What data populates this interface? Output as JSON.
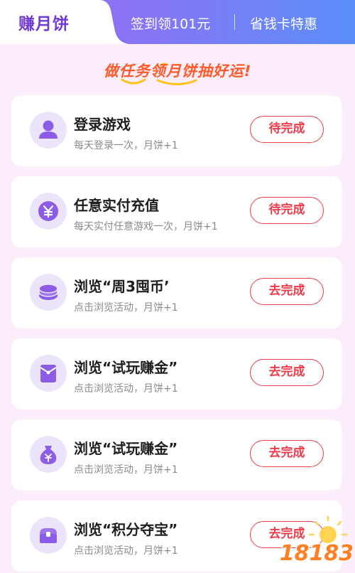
{
  "tabs": {
    "active_label": "赚月饼",
    "signin_label": "签到领101元",
    "savecard_label": "省钱卡特惠"
  },
  "slogan": "做任务领月饼抽好运!",
  "tasks": [
    {
      "title": "登录游戏",
      "desc": "每天登录一次，月饼+1",
      "button": "待完成",
      "icon": "user-icon"
    },
    {
      "title": "任意实付充值",
      "desc": "每天实付任意游戏一次，月饼+1",
      "button": "待完成",
      "icon": "yen-coin-icon"
    },
    {
      "title": "浏览“周3囤币’",
      "desc": "点击浏览活动，月饼+1",
      "button": "去完成",
      "icon": "coin-stack-icon"
    },
    {
      "title": "浏览“试玩赚金”",
      "desc": "点击浏览活动，月饼+1",
      "button": "去完成",
      "icon": "red-envelope-icon"
    },
    {
      "title": "浏览“试玩赚金”",
      "desc": "点击浏览活动，月饼+1",
      "button": "去完成",
      "icon": "money-bag-icon"
    },
    {
      "title": "浏览“积分夺宝”",
      "desc": "点击浏览活动，月饼+1",
      "button": "去完成",
      "icon": "treasure-chest-icon"
    }
  ],
  "watermark": "18183",
  "colors": {
    "background": "#fbeefa",
    "tab_gradient_start": "#9a5cf0",
    "tab_gradient_end": "#5b8ef8",
    "accent_purple": "#6f3bd2",
    "slogan": "#ff5a2a",
    "button_red": "#ee3b4a",
    "icon_bg": "#ece4fb",
    "icon_fg": "#8c5ce6"
  }
}
